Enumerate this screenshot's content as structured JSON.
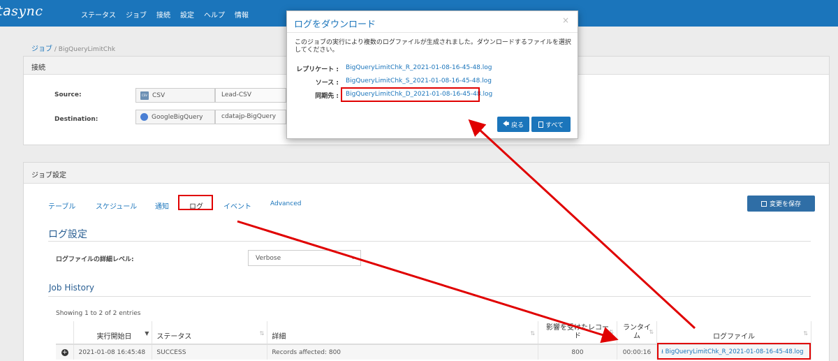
{
  "app": {
    "logo_left": "ta",
    "logo_right": "sync"
  },
  "nav": [
    "ステータス",
    "ジョブ",
    "接続",
    "設定",
    "ヘルプ",
    "情報"
  ],
  "breadcrumb": {
    "root": "ジョブ",
    "sep": "/",
    "current": "BigQueryLimitChk"
  },
  "connection": {
    "title": "接続",
    "source_label": "Source:",
    "source_type": "CSV",
    "source_type_icon_text": "CSV",
    "source_conn": "Lead-CSV",
    "dest_label": "Destination:",
    "dest_type": "GoogleBigQuery",
    "dest_conn": "cdatajp-BigQuery"
  },
  "job_settings": {
    "title": "ジョブ設定",
    "tabs": [
      "テーブル",
      "スケジュール",
      "通知",
      "ログ",
      "イベント",
      "Advanced"
    ],
    "save_label": "変更を保存"
  },
  "log_settings": {
    "title": "ログ設定",
    "level_label": "ログファイルの詳細レベル:",
    "level_value": "Verbose"
  },
  "history": {
    "title": "Job History",
    "showing": "Showing 1 to 2 of 2 entries",
    "columns": [
      "実行開始日",
      "ステータス",
      "詳細",
      "影響を受けたレコード",
      "ランタイム",
      "ログファイル"
    ],
    "rows": [
      {
        "start": "2021-01-08 16:45:48",
        "status": "SUCCESS",
        "details": "Records affected: 800",
        "affected": "800",
        "runtime": "00:00:16",
        "logfile": "BigQueryLimitChk_R_2021-01-08-16-45-48.log"
      }
    ]
  },
  "modal": {
    "title": "ログをダウンロード",
    "close": "×",
    "message": "このジョブの実行により複数のログファイルが生成されました。ダウンロードするファイルを選択してください。",
    "logs": [
      {
        "key": "レプリケート :",
        "file": "BigQueryLimitChk_R_2021-01-08-16-45-48.log"
      },
      {
        "key": "ソース :",
        "file": "BigQueryLimitChk_S_2021-01-08-16-45-48.log"
      },
      {
        "key": "同期先 :",
        "file": "BigQueryLimitChk_D_2021-01-08-16-45-48.log"
      }
    ],
    "back_label": "戻る",
    "all_label": "すべて"
  },
  "colors": {
    "topbar": "#1b75bb",
    "annotation_red": "#e00000",
    "link": "#1b75bb"
  }
}
